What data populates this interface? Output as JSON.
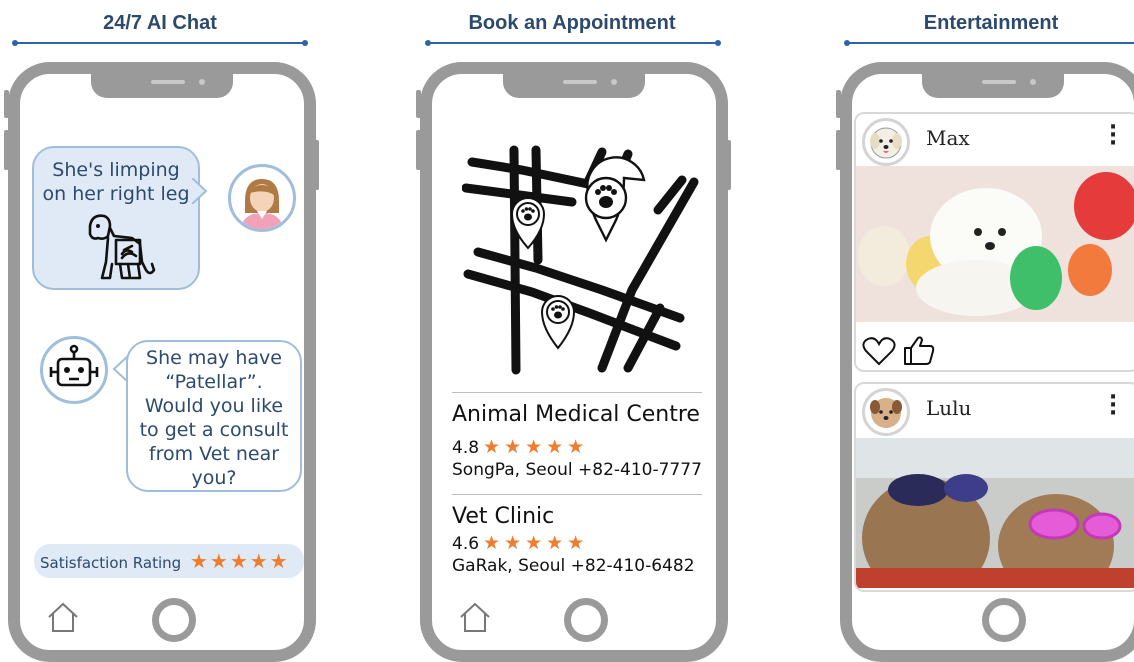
{
  "sections": {
    "chat_title": "24/7  AI Chat",
    "booking_title": "Book an Appointment",
    "entertainment_title": "Entertainment"
  },
  "chat": {
    "user_message_line1": "She's limping",
    "user_message_line2": "on her right leg",
    "bot_message_lines": [
      "She may have",
      "“Patellar”.",
      "Would you like",
      "to get a consult",
      "from Vet near",
      "you?"
    ],
    "rating_label": "Satisfaction Rating",
    "rating_stars": "★★★★★"
  },
  "booking": {
    "clinics": [
      {
        "name": "Animal Medical Centre",
        "rating": "4.8",
        "stars": "★★★★★",
        "address": "SongPa, Seoul  +82-410-7777"
      },
      {
        "name": "Vet Clinic",
        "rating": "4.6",
        "stars": "★★★★★",
        "address": "GaRak, Seoul  +82-410-6482"
      }
    ]
  },
  "feed": {
    "posts": [
      {
        "name": "Max"
      },
      {
        "name": "Lulu"
      }
    ]
  },
  "icons": {
    "home": "home-icon",
    "like": "heart-icon",
    "thumbs": "thumbs-up-icon",
    "more": "kebab-menu-icon"
  },
  "colors": {
    "accent": "#2f63a8",
    "title": "#2c4a6e",
    "bubble_fill": "#dfeaf6",
    "star": "#ee7d2e",
    "frame": "#9a9a9a"
  }
}
